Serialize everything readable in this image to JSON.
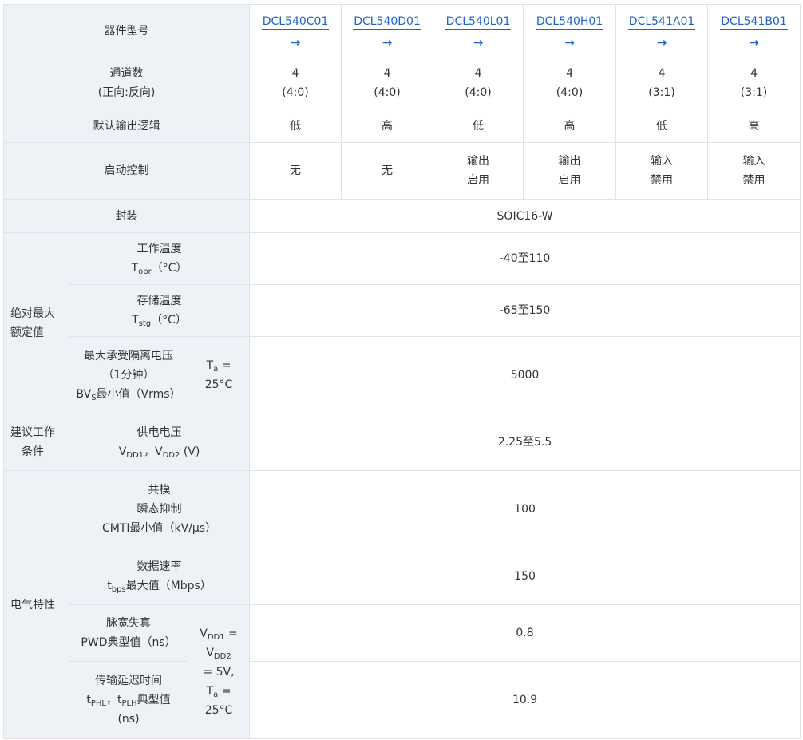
{
  "models": [
    {
      "name": "DCL540C01",
      "channels": "4",
      "ratio": "(4:0)",
      "default_output": "低",
      "enable": [
        "无"
      ]
    },
    {
      "name": "DCL540D01",
      "channels": "4",
      "ratio": "(4:0)",
      "default_output": "高",
      "enable": [
        "无"
      ]
    },
    {
      "name": "DCL540L01",
      "channels": "4",
      "ratio": "(4:0)",
      "default_output": "低",
      "enable": [
        "输出",
        "启用"
      ]
    },
    {
      "name": "DCL540H01",
      "channels": "4",
      "ratio": "(4:0)",
      "default_output": "高",
      "enable": [
        "输出",
        "启用"
      ]
    },
    {
      "name": "DCL541A01",
      "channels": "4",
      "ratio": "(3:1)",
      "default_output": "低",
      "enable": [
        "输入",
        "禁用"
      ]
    },
    {
      "name": "DCL541B01",
      "channels": "4",
      "ratio": "(3:1)",
      "default_output": "高",
      "enable": [
        "输入",
        "禁用"
      ]
    }
  ],
  "arrow_glyph": "→",
  "labels": {
    "part_number": "器件型号",
    "channels_1": "通道数",
    "channels_2": "(正向:反向)",
    "default_output": "默认输出逻辑",
    "enable_control": "启动控制",
    "package": "封装",
    "abs_max_1": "绝对最大",
    "abs_max_2": "额定值",
    "opr_temp_1": "工作温度",
    "opr_temp_sym": "T",
    "opr_temp_sub": "opr",
    "opr_temp_unit": "（°C）",
    "stg_temp_1": "存储温度",
    "stg_temp_sym": "T",
    "stg_temp_sub": "stg",
    "stg_temp_unit": "（°C）",
    "iso_1": "最大承受隔离电压",
    "iso_2": "（1分钟）",
    "iso_sym": "BV",
    "iso_sub": "S",
    "iso_3": "最小值（Vrms）",
    "ta_sym": "T",
    "ta_sub": "a",
    "ta_eq": " =",
    "ta_val": "25°C",
    "rec_1": "建议工作",
    "rec_2": "条件",
    "supply_1": "供电电压",
    "vdd": "V",
    "vdd1_sub": "DD1",
    "vdd_sep": "，",
    "vdd2_sub": "DD2",
    "vdd_unit": " (V)",
    "elec": "电气特性",
    "cmti_1": "共模",
    "cmti_2": "瞬态抑制",
    "cmti_3": "CMTI最小值（kV/μs）",
    "rate_1": "数据速率",
    "rate_sym": "t",
    "rate_sub": "bps",
    "rate_2": "最大值（Mbps）",
    "pwd_1": "脉宽失真",
    "pwd_2": "PWD典型值（ns）",
    "tpd_1": "传输延迟时间",
    "tpd_t": "t",
    "tpd_sub1": "PHL",
    "tpd_sep": "，",
    "tpd_sub2": "PLH",
    "tpd_2": "典型值",
    "tpd_3": "(ns)",
    "cond_eq": " =",
    "cond_5v": "= 5V,",
    "cond_ta_val": "25°C"
  },
  "values": {
    "package": "SOIC16-W",
    "opr_temp": "-40至110",
    "stg_temp": "-65至150",
    "isolation": "5000",
    "supply": "2.25至5.5",
    "cmti": "100",
    "data_rate": "150",
    "pwd": "0.8",
    "tpd": "10.9"
  }
}
